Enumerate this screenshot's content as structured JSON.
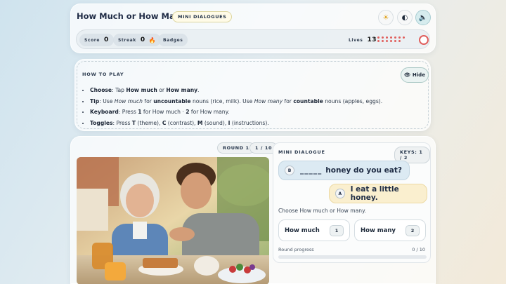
{
  "header": {
    "title": "How Much or How Many?",
    "mode_chip": "Mini Dialogues",
    "buttons": [
      "sun-icon",
      "contrast-icon",
      "sound-icon"
    ]
  },
  "stats": {
    "score_label": "Score",
    "score": "0",
    "streak_label": "Streak",
    "streak": "0",
    "badges_label": "Badges",
    "lives_label": "Lives",
    "lives": "13",
    "lives_color": "#e0605e"
  },
  "howto": {
    "title": "How to play",
    "hide_label": "Hide",
    "choose": {
      "label": "Choose",
      "text1": ": Tap ",
      "opt1": "How much",
      "text2": " or ",
      "opt2": "How many",
      "text3": "."
    },
    "tip": {
      "label": "Tip",
      "t1": ": Use ",
      "e1": "How much",
      "t2": " for ",
      "b1": "uncountable",
      "t3": " nouns (rice, milk). Use ",
      "e2": "How many",
      "t4": " for ",
      "b2": "countable",
      "t5": " nouns (apples, eggs)."
    },
    "keyboard": {
      "label": "Keyboard",
      "t1": ": Press ",
      "k1": "1",
      "t2": " for How much · ",
      "k2": "2",
      "t3": " for How many."
    },
    "toggles": {
      "label": "Toggles",
      "t1": ": Press ",
      "k1": "T",
      "t2": " (theme), ",
      "k2": "C",
      "t3": " (contrast), ",
      "k3": "M",
      "t4": " (sound), ",
      "k4": "I",
      "t5": " (instructions)."
    }
  },
  "round": {
    "label": "Round 1",
    "count": "1 / 10"
  },
  "dialogue": {
    "title": "Mini dialogue",
    "keys_chip": "Keys: 1 / 2",
    "speaker_b": "B",
    "blank": "_____",
    "question_rest": "honey do you eat?",
    "speaker_a": "A",
    "answer": "I eat a little honey.",
    "prompt": "Choose How much or How many.",
    "choice1": {
      "label": "How much",
      "key": "1"
    },
    "choice2": {
      "label": "How many",
      "key": "2"
    },
    "progress_label": "Round progress",
    "progress_text": "0 / 10",
    "progress_fraction": 0
  }
}
